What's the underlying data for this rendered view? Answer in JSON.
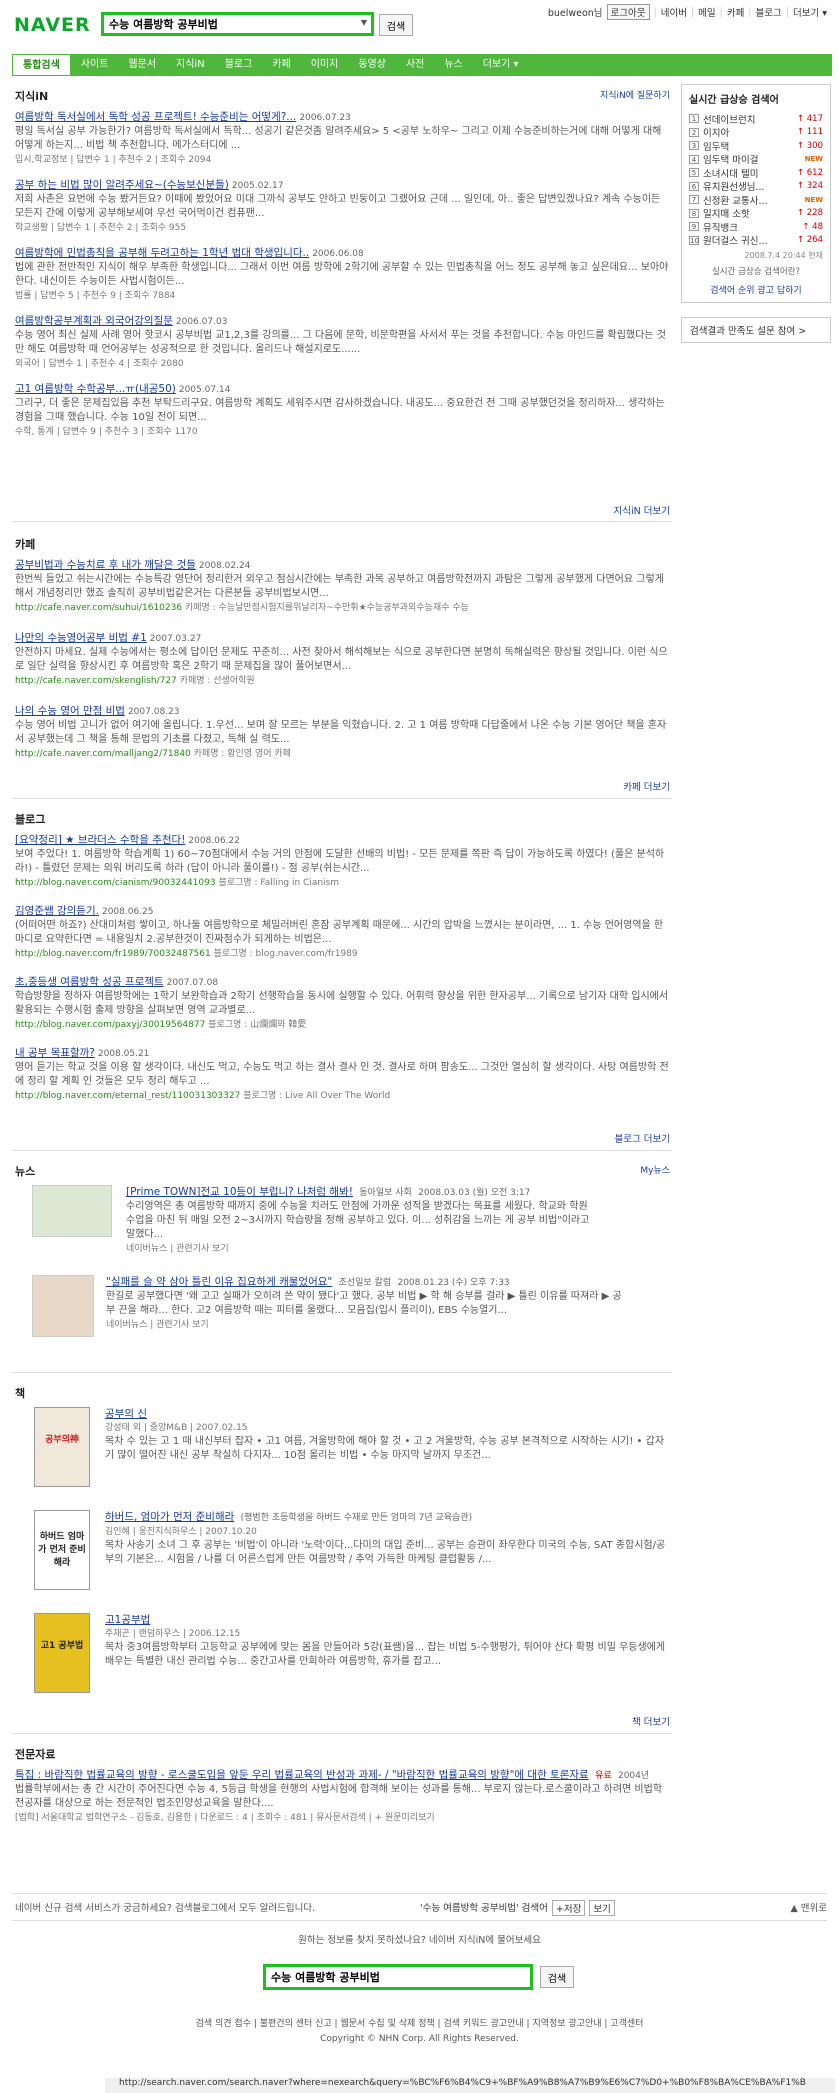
{
  "header": {
    "logo": "NAVER",
    "search_value": "수능 여름방학 공부비법",
    "search_button": "검색",
    "user": "buelweon님",
    "logout": "로그아웃",
    "links": [
      "네이버",
      "메일",
      "카페",
      "블로그",
      "더보기 ▾"
    ]
  },
  "nav": {
    "tabs": [
      "통합검색",
      "사이트",
      "웹문서",
      "지식iN",
      "블로그",
      "카페",
      "이미지",
      "동영상",
      "사전",
      "뉴스",
      "더보기 ▾"
    ]
  },
  "jisik": {
    "title": "지식iN",
    "tool": "지식iN에 질문하기",
    "items": [
      {
        "title": "여름방학 독서실에서 독학 성공 프로젝트! 수능준비는 어떻게?...",
        "date": "2006.07.23",
        "desc": "평일 독서실 공부 가능한가? 여름방학 독서실에서 독학... 성공기 같은것좀 알려주세요> 5 <공부 노하우~ 그리고 이제 수능준비하는거에 대해 어떻게 대해 어떻게 하는지... 비법 책 추천합니다. 메가스터디에 ...",
        "meta": "입시,학교정보 | 답변수 1 | 추천수 2 | 조회수 2094"
      },
      {
        "title": "공부 하는 비법 많이 알려주세요~(수능보신분들)",
        "date": "2005.02.17",
        "desc": "저희 사촌은 요번에 수능 봤거든요? 이때에 봤었어요 미대 그까식 공부도 안하고 빈둥이고 그랬어요 근데 ... 일인데, 아.. 좋은 답변있겠나요? 계속 수능이든 모든지 간에 이렇게 공부해보세여 우선 국어먹이건 컴퓨팬...",
        "meta": "학교생활 | 답변수 1 | 추천수 2 | 조회수 955"
      },
      {
        "title": "여름방학에 민법총칙을 공부해 두려고하는 1학년 법대 학생입니다..",
        "date": "2006.06.08",
        "desc": "법에 관한 전반적인 지식이 해우 부족한 학생입니다... 그래서 이번 여름 방학에 2학기에 공부할 수 있는 민법총칙을 어느 정도 공부해 놓고 싶은데요... 보아야 한다. 내신이든 수능이든 사법시험이든...",
        "meta": "법률 | 답변수 5 | 추천수 9 | 조회수 7884"
      },
      {
        "title": "여름방학공부계획과 외국어강의질문",
        "date": "2006.07.03",
        "desc": "수능 영어 최신 실제 사례 영어 핫코시 공부비법 교1,2,3를 강의를... 그 다음에 문학, 비문학편을 사서서 푸는 것을 추천합니다. 수능 마인드를 확립했다는 것만 해도 여름방학 때 언어공부는 성공적으로 한 것입니다. 올리드나 해설지로도......",
        "meta": "외국어 | 답변수 1 | 추천수 4 | 조회수 2080"
      },
      {
        "title": "고1 여름방학 수학공부...ㅠ(내공50)",
        "date": "2005.07.14",
        "desc": "그리구, 더 좋은 문제집있음 추천 부탁드리구요. 여름방학 계획도 세워주시면 감사하겠습니다. 내공도... 중요한건 전 그때 공부했던것을 정리하자... 생각하는 경험을 그때 했습니다. 수능 10일 전이 되면...",
        "meta": "수학, 통계 | 답변수 9 | 추천수 3 | 조회수 1170"
      }
    ],
    "more": "지식iN 더보기"
  },
  "cafe": {
    "title": "카페",
    "items": [
      {
        "title": "공부비법과 수능치료 후 내가 깨달은 것들",
        "date": "2008.02.24",
        "desc": "한번씩 들었고 쉬는시간에는 수능특강 영단어 정리한거 외우고 점심시간에는 부족한 과목 공부하고 여름방학전까지 과탐은 그렇게 공부했게 다면어요 그렇게해서 개념정리만 했죠 솔직히 공부비법같은거는 다른분들 공부비법보시면...",
        "url": "http://cafe.naver.com/suhui/1610236",
        "cafe": "카페명 : 수능날만점시험지를위날리자~수만휘★수능공부과외수능재수 수능"
      },
      {
        "title": "나만의 수능영어공부 비법 #1",
        "date": "2007.03.27",
        "desc": "안전하지 마세요. 실제 수능에서는 평소에 답이던 문제도 꾸준히... 사전 찾아서 해석해보는 식으로 공부한다면 분명히 독해실력은 향상될 것입니다. 이런 식으로 일단 실력을 향상시킨 후 여름방학 혹은 2학기 때 문제집을 많이 풀어보면서...",
        "url": "http://cafe.naver.com/skenglish/727",
        "cafe": "카페명 : 선생어학원"
      },
      {
        "title": "나의 수능 영어 만점 비법",
        "date": "2007.08.23",
        "desc": "수능 영어 비법 고니가 없어 여기에 올립니다. 1.우선... 보며 잘 모르는 부분을 익혔습니다. 2. 고 1 여름 방학때 다답줄에서 나온 수능 기본 영어단 책을 혼자서 공부했는데 그 책을 통해 문법의 기초를 다졌고, 독해 실 력도...",
        "url": "http://cafe.naver.com/malljang2/71840",
        "cafe": "카페명 : 황인영 영어 카페"
      }
    ],
    "more": "카페 더보기"
  },
  "blog": {
    "title": "블로그",
    "items": [
      {
        "title": "[요약정리] ★ 브라더스 수학을 추천다!",
        "date": "2008.06.22",
        "desc": "보여 주었다! 1. 여름방학 학습계획 1) 60~70점대에서 수능 거의 만점에 도달한 선배의 비법! - 모든 문제를 쪽판 즉 답이 가능하도록 하였다! (풀은 분석하라!) - 틀렸던 문제는 외워 버리도록 하라 (답이 아니라 풀이를!) - 점 공부(쉬는시간...",
        "url": "http://blog.naver.com/cianism/90032441093",
        "blog": "블로그명 : Falling in Cianism"
      },
      {
        "title": "김영준쌤 강의듣기.",
        "date": "2008.06.25",
        "desc": "(어떠어떤 하죠?) 산대미처럼 쌓이고, 하나둘 여름방학으로 체밀러버린 혼잠 공부계획 때문에... 시간의 압박을 느꼈시는 분이라면, ... 1. 수능 언어영역을 한마디로 요약한다면 = 내용일치 2.공부한것이 진짜점수가 되게하는 비법은...",
        "url": "http://blog.naver.com/fr1989/70032487561",
        "blog": "블로그명 : blog.naver.com/fr1989"
      },
      {
        "title": "초,중등생 여름방학 성공 프로젝트",
        "date": "2007.07.08",
        "desc": "학습방향을 정하자 여름방학에는 1학기 보완학습과 2학기 선행학습을 동시에 실행할 수 있다. 어휘력 향상을 위한 한자공부... 기록으로 남기자 대학 입시에서 활용되는 수행시험 출제 방향을 살펴보면 영역 교과별로...",
        "url": "http://blog.naver.com/paxyj/30019564877",
        "blog": "블로그명 : 山爛爛와 韓愛"
      },
      {
        "title": "내 공부 목표할까?",
        "date": "2008.05.21",
        "desc": "영어 듣기는 학교 것을 이용 할 생각이다. 내신도 먹고, 수능도 먹고 하는 결사 결사 인 것. 결사로 하며 팜송도... 그것만 열심히 할 생각이다. 사탕 여름방학 전에 정리 할 계획 인 것들은 모두 정리 해두고 ...",
        "url": "http://blog.naver.com/eternal_rest/110031303327",
        "blog": "블로그명 : Live All Over The World"
      }
    ],
    "more": "블로그 더보기"
  },
  "news": {
    "title": "뉴스",
    "tool": "My뉴스",
    "items": [
      {
        "title": "[Prime TOWN]전교 10등이 부럽니? 나처럼 해봐!",
        "source": "동아일보 사회",
        "date": "2008.03.03 (월) 오전 3:17",
        "desc": "수리영역은 총 여름방학 때까지 중에 수능을 치러도 만점에 가까운 성적을 받겠다는 목표를 세웠다. 학교와 학원 수업을 마친 뒤 매일 오전 2~3시까지 학습량을 정해 공부하고 있다. 이... 성취감을 느끼는 게 공부 비법\"이라고 말했다...",
        "links": "네이버뉴스 | 관련기사 보기"
      },
      {
        "title": "\"실패를 슬 약 삼아 틀린 이유 집요하게 캐물었어요\"",
        "source": "조선일보 칼럼",
        "date": "2008.01.23 (수) 오후 7:33",
        "desc": "한길로 공부했다면 '왜 고고 실패가 오히려 쓴 약이 됐다'고 했다. 공부 비법 ▶ 학 해 승부를 걸라 ▶ 틀린 이유를 따져라 ▶ 공부 끈을 해라... 한다. 고2 여름방학 때는 피터를 울랬다... 모음집(입시 플리이), EBS 수능열기...",
        "links": "네이버뉴스 | 관련기사 보기"
      }
    ]
  },
  "book": {
    "title": "책",
    "items": [
      {
        "title": "공부의 신",
        "author": "강성태 외 | 중앙M&B | 2007.02.15",
        "desc": "목차 수 있는 고 1 때 내신부터 잡자 • 고1 여름, 겨울방학에 해야 할 것 • 고 2 겨울방학, 수능 공부 본격적으로 시작하는 시기! • 갑자기 많이 떨어진 내신 공부 착실히 다지자... 10점 올리는 비법 • 수능 마지막 날까지 무조건...",
        "cover": "공부의神"
      },
      {
        "title": "하버드, 엄마가 먼저 준비해라",
        "sub": "(평범한 초등학생을 하버드 수재로 만든 엄마의 7년 교육습관)",
        "author": "김인혜 | 웅진지식하우스 | 2007.10.20",
        "desc": "목차 사송기 소녀 그 후 공부는 '비법'이 아니라 '노력'이다...다미의 대입 준비... 공부는 승관이 좌우한다 미국의 수능, SAT 종합시험/공부의 기본은... 시험을 / 나를 더 어른스럽게 만든 여름방학 / 추억 가득한 마케팅 클럽활동 /...",
        "cover": "하버드 엄마가 먼저 준비해라"
      },
      {
        "title": "고1공부법",
        "author": "주재곤 | 랜덤하우스 | 2006.12.15",
        "desc": "목차 중3여름방학부터 고등학교 공부에에 맞는 몸을 만들어라 5강(표쌤)을... 잡는 비법 5-수행평가, 튀어야 산다 확평 비밀 우등생에게 배우는 특별한 내신 관리법 수능... 중간고사를 만회하라 여름방학, 휴가를 잡고...",
        "cover": "고1 공부법"
      }
    ],
    "more": "책 더보기"
  },
  "paper": {
    "title": "전문자료",
    "items": [
      {
        "title": "특집 : 바람직한 법률교육의 방향 - 로스쿨도입을 앞둔 우리 법률교육의 반성과 과제- / \"바람직한 법률교육의 방향\"에 대한 토론자료",
        "badge": "유료",
        "date": "2004년",
        "desc": "법률학부에서는 총 간 시간이 주어진다면 수능 4, 5등급 학생을 현행의 사법시험에 합격해 보이는 성과를 통해... 부로지 않는다.로스쿨이라고 하려면 비법학전공자를 대상으로 하는 전문적인 법조인양성교육을 말한다....",
        "meta": "[법학] 서울대학교 법학연구소 - 김동호, 김용한 | 다운로드 : 4 | 조회수 : 481 | 유사문서검색 | + 원문미리보기"
      }
    ]
  },
  "sidebar": {
    "title": "실시간 급상승 검색어",
    "ranks": [
      {
        "n": "1",
        "k": "선데이브런치",
        "v": "↑ 417"
      },
      {
        "n": "2",
        "k": "이지아",
        "v": "↑ 111"
      },
      {
        "n": "3",
        "k": "임두택",
        "v": "↑ 300"
      },
      {
        "n": "4",
        "k": "임두택 마이걸",
        "v": "NEW"
      },
      {
        "n": "5",
        "k": "소녀시대 텔미",
        "v": "↑ 612"
      },
      {
        "n": "6",
        "k": "유치원선생님...",
        "v": "↑ 324"
      },
      {
        "n": "7",
        "k": "신정환 교통사...",
        "v": "NEW"
      },
      {
        "n": "8",
        "k": "일지매 소핫",
        "v": "↑ 228"
      },
      {
        "n": "9",
        "k": "뮤직뱅크",
        "v": "↑ 48"
      },
      {
        "n": "10",
        "k": "원더걸스 귀신...",
        "v": "↑ 264"
      }
    ],
    "time": "2008.7.4 20:44 현재",
    "q": "실시간 급상승 검색어란?",
    "link": "검색어 순위 광고 답하기",
    "survey": "검색결과 만족도 설문 참여 >"
  },
  "footer": {
    "notice": "네이버 신규 검색 서비스가 궁금하세요? 검색블로그에서 모두 알려드립니다.",
    "query_label": "'수능 여름방학 공부비법' 검색어",
    "save": "+저장",
    "view": "보기",
    "top": "▲ 맨위로",
    "ask": "원하는 정보를 찾지 못하셨나요? 네이버 지식iN에 물어보세요",
    "search_value": "수능 여름방학 공부비법",
    "search_button": "검색",
    "links": "검색 의견 접수 | 불편건의 센터 신고 | 웹문서 수집 및 삭제 정책 | 검색 키워드 광고안내 | 지역정보 광고안내 | 고객센터",
    "copyright": "Copyright © NHN Corp. All Rights Reserved.",
    "status_url": "http://search.naver.com/search.naver?where=nexearch&query=%BC%F6%B4%C9+%BF%A9%B8%A7%B9%E6%C7%D0+%B0%F8%BA%CE%BA%F1%B"
  }
}
